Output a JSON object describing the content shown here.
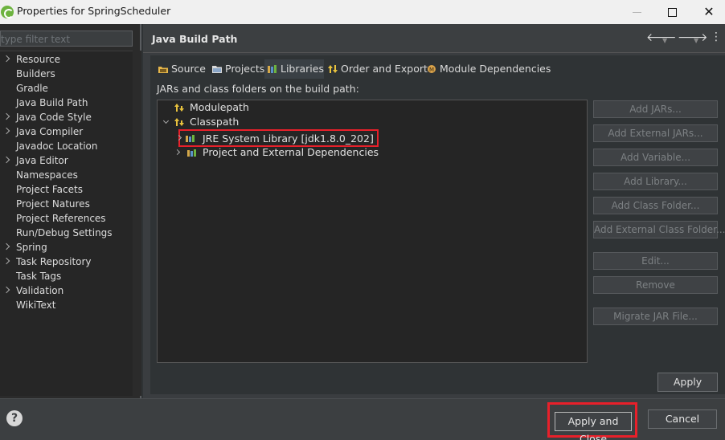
{
  "window": {
    "title": "Properties for SpringScheduler",
    "icon": "spring-leaf-icon"
  },
  "filter": {
    "placeholder": "type filter text"
  },
  "nav": {
    "items": [
      {
        "label": "Resource",
        "expandable": true
      },
      {
        "label": "Builders",
        "expandable": false
      },
      {
        "label": "Gradle",
        "expandable": false
      },
      {
        "label": "Java Build Path",
        "expandable": false
      },
      {
        "label": "Java Code Style",
        "expandable": true
      },
      {
        "label": "Java Compiler",
        "expandable": true
      },
      {
        "label": "Javadoc Location",
        "expandable": false
      },
      {
        "label": "Java Editor",
        "expandable": true
      },
      {
        "label": "Namespaces",
        "expandable": false
      },
      {
        "label": "Project Facets",
        "expandable": false
      },
      {
        "label": "Project Natures",
        "expandable": false
      },
      {
        "label": "Project References",
        "expandable": false
      },
      {
        "label": "Run/Debug Settings",
        "expandable": false
      },
      {
        "label": "Spring",
        "expandable": true
      },
      {
        "label": "Task Repository",
        "expandable": true
      },
      {
        "label": "Task Tags",
        "expandable": false
      },
      {
        "label": "Validation",
        "expandable": true
      },
      {
        "label": "WikiText",
        "expandable": false
      }
    ]
  },
  "page": {
    "title": "Java Build Path",
    "tabs": [
      {
        "label": "Source",
        "icon": "source-folder-icon"
      },
      {
        "label": "Projects",
        "icon": "projects-icon"
      },
      {
        "label": "Libraries",
        "icon": "libraries-icon"
      },
      {
        "label": "Order and Export",
        "icon": "order-export-icon"
      },
      {
        "label": "Module Dependencies",
        "icon": "module-icon"
      }
    ],
    "active_tab": "Libraries",
    "description": "JARs and class folders on the build path:",
    "tree": {
      "modulepath": "Modulepath",
      "classpath": "Classpath",
      "jre": "JRE System Library [jdk1.8.0_202]",
      "external": "Project and External Dependencies"
    },
    "buttons": {
      "add_jars": "Add JARs...",
      "add_external_jars": "Add External JARs...",
      "add_variable": "Add Variable...",
      "add_library": "Add Library...",
      "add_class_folder": "Add Class Folder...",
      "add_external_class_folder": "Add External Class Folder...",
      "edit": "Edit...",
      "remove": "Remove",
      "migrate": "Migrate JAR File...",
      "apply": "Apply"
    }
  },
  "footer": {
    "help": "?",
    "apply_and_close": "Apply and Close",
    "cancel": "Cancel"
  },
  "colors": {
    "highlight": "#e8202a",
    "background": "#2f3335",
    "spring_green": "#6db33f"
  }
}
